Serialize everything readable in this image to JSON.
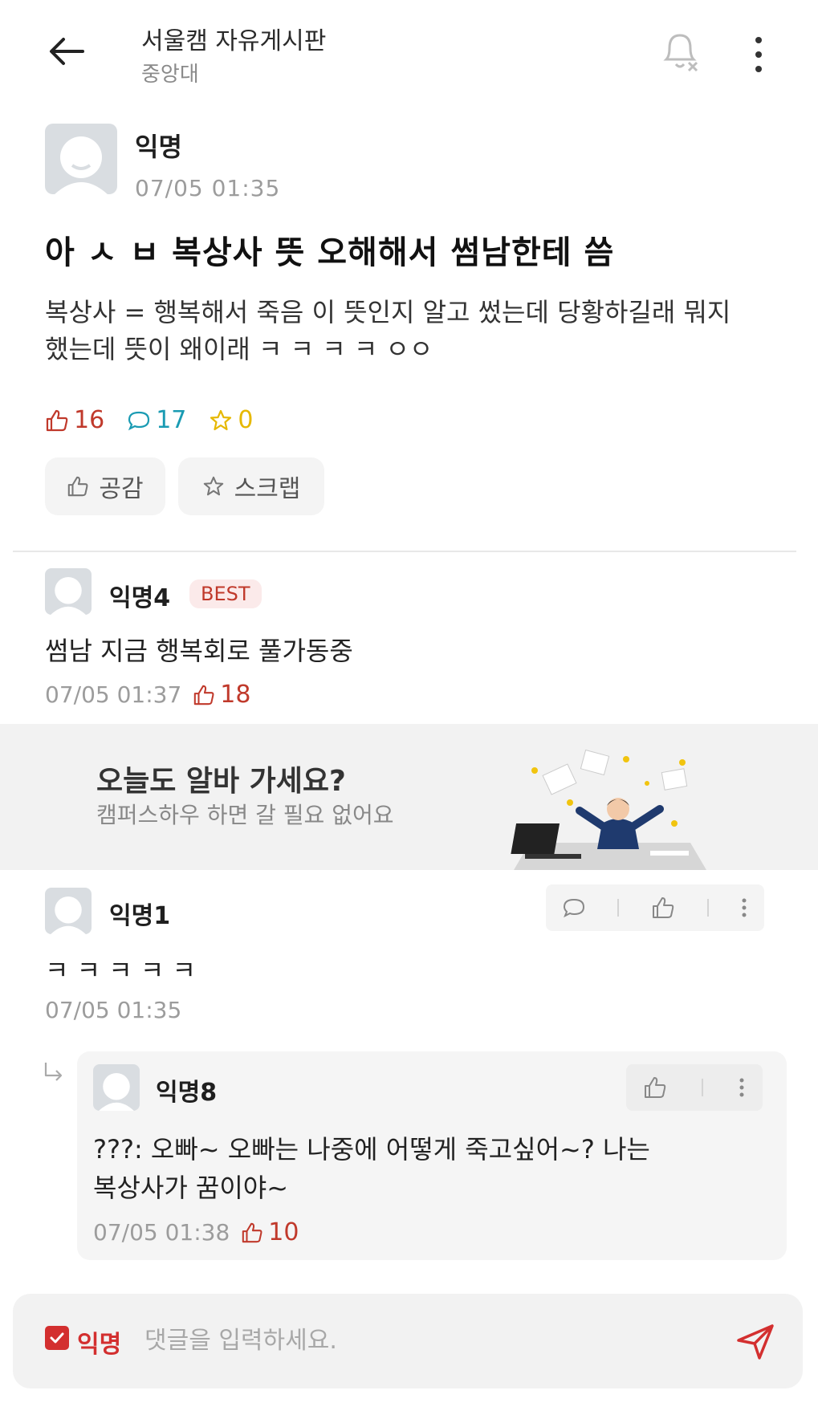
{
  "header": {
    "board_title": "서울캠 자유게시판",
    "board_sub": "중앙대"
  },
  "post": {
    "author": "익명",
    "time": "07/05 01:35",
    "title": "아 ㅅ ㅂ 복상사 뜻 오해해서 썸남한테 씀",
    "body_line1": "복상사 = 행복해서 죽음 이 뜻인지 알고 썼는데 당황하길래 뭐지",
    "body_line2": "했는데 뜻이 왜이래 ㅋ ㅋ ㅋ ㅋ ㅇㅇ",
    "likes": "16",
    "comments": "17",
    "scraps": "0",
    "like_button": "공감",
    "scrap_button": "스크랩"
  },
  "best_comment": {
    "author": "익명4",
    "badge": "BEST",
    "text": "썸남 지금 행복회로 풀가동중",
    "time": "07/05 01:37",
    "likes": "18"
  },
  "ad": {
    "title": "오늘도 알바 가세요?",
    "subtitle": "캠퍼스하우 하면 갈 필요 없어요"
  },
  "comment1": {
    "author": "익명1",
    "text": "ㅋ ㅋ ㅋ ㅋ ㅋ",
    "time": "07/05 01:35"
  },
  "reply": {
    "author": "익명8",
    "text_line1": "???: 오빠~ 오빠는 나중에 어떻게 죽고싶어~? 나는",
    "text_line2": "복상사가 꿈이야~",
    "time": "07/05 01:38",
    "likes": "10"
  },
  "input": {
    "anon_label": "익명",
    "placeholder": "댓글을 입력하세요."
  },
  "colors": {
    "accent": "#d32f2f",
    "comment_teal": "#1a9bb3",
    "scrap_yellow": "#e6b800"
  }
}
